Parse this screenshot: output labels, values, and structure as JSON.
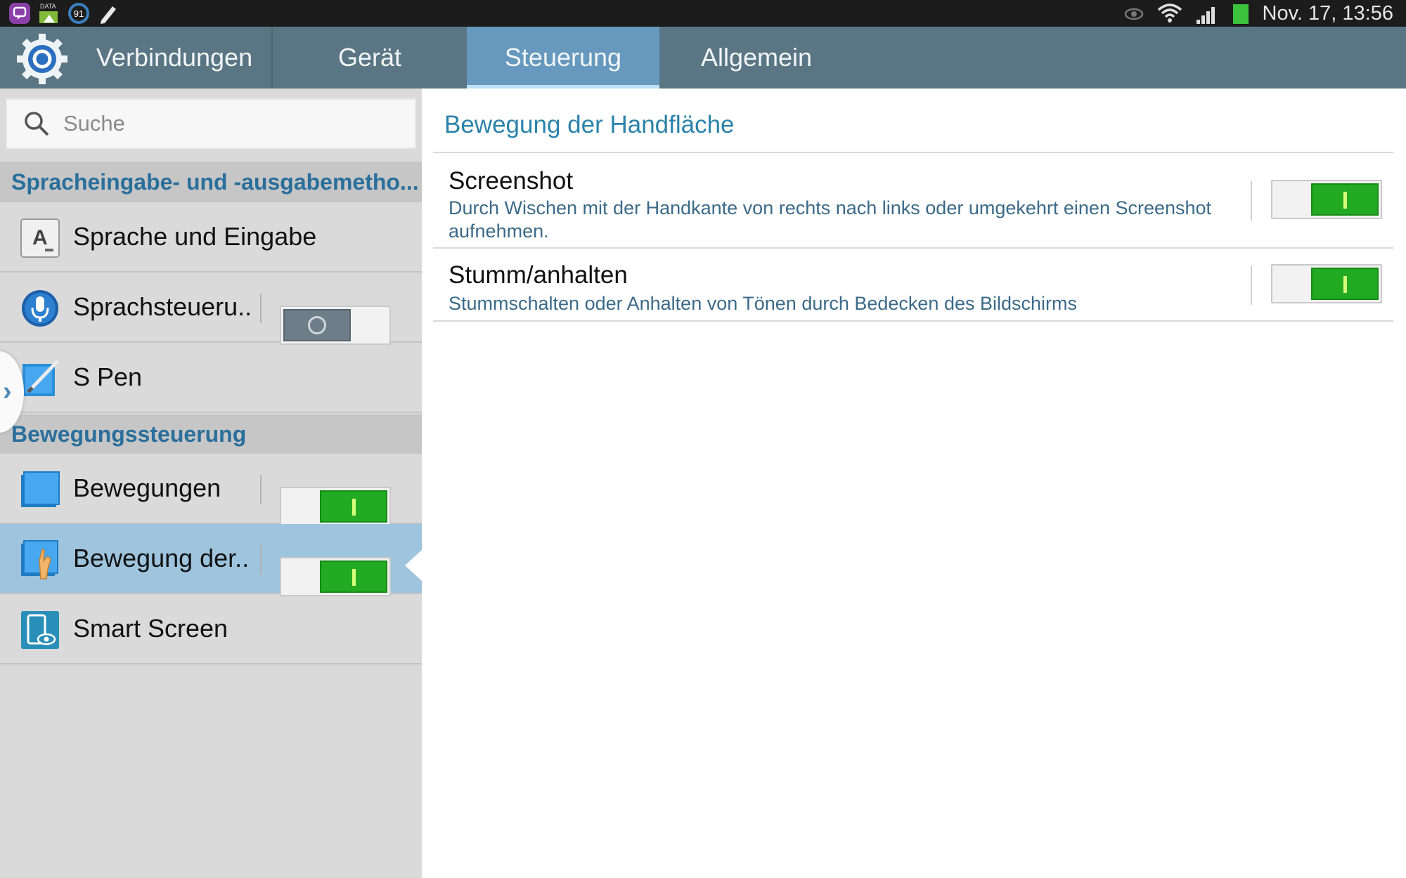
{
  "status_bar": {
    "time": "Nov. 17, 13:56",
    "left_icons": [
      "chat-app-icon",
      "data-transfer-icon",
      "notification-count-icon",
      "pen-edit-icon"
    ],
    "notification_count": "91",
    "data_label": "DATA",
    "right_icons": [
      "smart-stay-eye-icon",
      "wifi-icon",
      "signal-icon",
      "battery-icon"
    ]
  },
  "tabs": [
    {
      "label": "Verbindungen",
      "active": false
    },
    {
      "label": "Gerät",
      "active": false
    },
    {
      "label": "Steuerung",
      "active": true
    },
    {
      "label": "Allgemein",
      "active": false
    }
  ],
  "sidebar": {
    "search_placeholder": "Suche",
    "sections": [
      {
        "header": "Spracheingabe- und -ausgabemetho...",
        "items": [
          {
            "label": "Sprache und Eingabe",
            "icon": "language-input-icon",
            "toggle": null
          },
          {
            "label": "Sprachsteueru..",
            "icon": "microphone-icon",
            "toggle": "off"
          },
          {
            "label": "S Pen",
            "icon": "s-pen-icon",
            "toggle": null
          }
        ]
      },
      {
        "header": "Bewegungssteuerung",
        "items": [
          {
            "label": "Bewegungen",
            "icon": "motion-icon",
            "toggle": "on"
          },
          {
            "label": "Bewegung der..",
            "icon": "palm-motion-icon",
            "toggle": "on",
            "selected": true
          },
          {
            "label": "Smart Screen",
            "icon": "smart-screen-icon",
            "toggle": null
          }
        ]
      }
    ]
  },
  "main": {
    "title": "Bewegung der Handfläche",
    "settings": [
      {
        "title": "Screenshot",
        "description": "Durch Wischen mit der Handkante von rechts nach links oder umgekehrt einen Screenshot aufnehmen.",
        "toggle": "on"
      },
      {
        "title": "Stumm/anhalten",
        "description": "Stummschalten oder Anhalten von Tönen durch Bedecken des Bildschirms",
        "toggle": "on"
      }
    ]
  },
  "colors": {
    "tab_bar": "#5a7685",
    "active_tab": "#6699bd",
    "section_header_text": "#2a6f9c",
    "toggle_on": "#22aa22",
    "selected_row": "#9ec4de"
  }
}
